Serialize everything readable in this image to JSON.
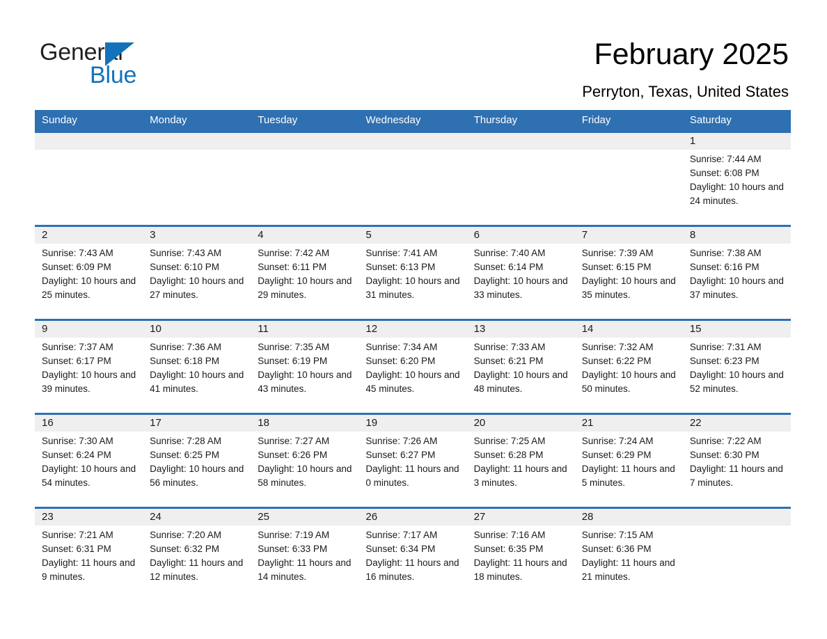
{
  "brand": {
    "name_part1": "General",
    "name_part2": "Blue",
    "triangle_color": "#1273ba",
    "text_color": "#231f20"
  },
  "header": {
    "title": "February 2025",
    "subtitle": "Perryton, Texas, United States"
  },
  "theme": {
    "header_bar_color": "#2E70B2",
    "day_band_color": "#efefef",
    "text_color": "#1a1a1a",
    "background": "#ffffff"
  },
  "weekdays": [
    "Sunday",
    "Monday",
    "Tuesday",
    "Wednesday",
    "Thursday",
    "Friday",
    "Saturday"
  ],
  "labels": {
    "sunrise_prefix": "Sunrise:",
    "sunset_prefix": "Sunset:",
    "daylight_prefix": "Daylight:"
  },
  "weeks": [
    [
      {
        "day": "",
        "empty": true
      },
      {
        "day": "",
        "empty": true
      },
      {
        "day": "",
        "empty": true
      },
      {
        "day": "",
        "empty": true
      },
      {
        "day": "",
        "empty": true
      },
      {
        "day": "",
        "empty": true
      },
      {
        "day": "1",
        "sunrise": "Sunrise: 7:44 AM",
        "sunset": "Sunset: 6:08 PM",
        "daylight": "Daylight: 10 hours and 24 minutes."
      }
    ],
    [
      {
        "day": "2",
        "sunrise": "Sunrise: 7:43 AM",
        "sunset": "Sunset: 6:09 PM",
        "daylight": "Daylight: 10 hours and 25 minutes."
      },
      {
        "day": "3",
        "sunrise": "Sunrise: 7:43 AM",
        "sunset": "Sunset: 6:10 PM",
        "daylight": "Daylight: 10 hours and 27 minutes."
      },
      {
        "day": "4",
        "sunrise": "Sunrise: 7:42 AM",
        "sunset": "Sunset: 6:11 PM",
        "daylight": "Daylight: 10 hours and 29 minutes."
      },
      {
        "day": "5",
        "sunrise": "Sunrise: 7:41 AM",
        "sunset": "Sunset: 6:13 PM",
        "daylight": "Daylight: 10 hours and 31 minutes."
      },
      {
        "day": "6",
        "sunrise": "Sunrise: 7:40 AM",
        "sunset": "Sunset: 6:14 PM",
        "daylight": "Daylight: 10 hours and 33 minutes."
      },
      {
        "day": "7",
        "sunrise": "Sunrise: 7:39 AM",
        "sunset": "Sunset: 6:15 PM",
        "daylight": "Daylight: 10 hours and 35 minutes."
      },
      {
        "day": "8",
        "sunrise": "Sunrise: 7:38 AM",
        "sunset": "Sunset: 6:16 PM",
        "daylight": "Daylight: 10 hours and 37 minutes."
      }
    ],
    [
      {
        "day": "9",
        "sunrise": "Sunrise: 7:37 AM",
        "sunset": "Sunset: 6:17 PM",
        "daylight": "Daylight: 10 hours and 39 minutes."
      },
      {
        "day": "10",
        "sunrise": "Sunrise: 7:36 AM",
        "sunset": "Sunset: 6:18 PM",
        "daylight": "Daylight: 10 hours and 41 minutes."
      },
      {
        "day": "11",
        "sunrise": "Sunrise: 7:35 AM",
        "sunset": "Sunset: 6:19 PM",
        "daylight": "Daylight: 10 hours and 43 minutes."
      },
      {
        "day": "12",
        "sunrise": "Sunrise: 7:34 AM",
        "sunset": "Sunset: 6:20 PM",
        "daylight": "Daylight: 10 hours and 45 minutes."
      },
      {
        "day": "13",
        "sunrise": "Sunrise: 7:33 AM",
        "sunset": "Sunset: 6:21 PM",
        "daylight": "Daylight: 10 hours and 48 minutes."
      },
      {
        "day": "14",
        "sunrise": "Sunrise: 7:32 AM",
        "sunset": "Sunset: 6:22 PM",
        "daylight": "Daylight: 10 hours and 50 minutes."
      },
      {
        "day": "15",
        "sunrise": "Sunrise: 7:31 AM",
        "sunset": "Sunset: 6:23 PM",
        "daylight": "Daylight: 10 hours and 52 minutes."
      }
    ],
    [
      {
        "day": "16",
        "sunrise": "Sunrise: 7:30 AM",
        "sunset": "Sunset: 6:24 PM",
        "daylight": "Daylight: 10 hours and 54 minutes."
      },
      {
        "day": "17",
        "sunrise": "Sunrise: 7:28 AM",
        "sunset": "Sunset: 6:25 PM",
        "daylight": "Daylight: 10 hours and 56 minutes."
      },
      {
        "day": "18",
        "sunrise": "Sunrise: 7:27 AM",
        "sunset": "Sunset: 6:26 PM",
        "daylight": "Daylight: 10 hours and 58 minutes."
      },
      {
        "day": "19",
        "sunrise": "Sunrise: 7:26 AM",
        "sunset": "Sunset: 6:27 PM",
        "daylight": "Daylight: 11 hours and 0 minutes."
      },
      {
        "day": "20",
        "sunrise": "Sunrise: 7:25 AM",
        "sunset": "Sunset: 6:28 PM",
        "daylight": "Daylight: 11 hours and 3 minutes."
      },
      {
        "day": "21",
        "sunrise": "Sunrise: 7:24 AM",
        "sunset": "Sunset: 6:29 PM",
        "daylight": "Daylight: 11 hours and 5 minutes."
      },
      {
        "day": "22",
        "sunrise": "Sunrise: 7:22 AM",
        "sunset": "Sunset: 6:30 PM",
        "daylight": "Daylight: 11 hours and 7 minutes."
      }
    ],
    [
      {
        "day": "23",
        "sunrise": "Sunrise: 7:21 AM",
        "sunset": "Sunset: 6:31 PM",
        "daylight": "Daylight: 11 hours and 9 minutes."
      },
      {
        "day": "24",
        "sunrise": "Sunrise: 7:20 AM",
        "sunset": "Sunset: 6:32 PM",
        "daylight": "Daylight: 11 hours and 12 minutes."
      },
      {
        "day": "25",
        "sunrise": "Sunrise: 7:19 AM",
        "sunset": "Sunset: 6:33 PM",
        "daylight": "Daylight: 11 hours and 14 minutes."
      },
      {
        "day": "26",
        "sunrise": "Sunrise: 7:17 AM",
        "sunset": "Sunset: 6:34 PM",
        "daylight": "Daylight: 11 hours and 16 minutes."
      },
      {
        "day": "27",
        "sunrise": "Sunrise: 7:16 AM",
        "sunset": "Sunset: 6:35 PM",
        "daylight": "Daylight: 11 hours and 18 minutes."
      },
      {
        "day": "28",
        "sunrise": "Sunrise: 7:15 AM",
        "sunset": "Sunset: 6:36 PM",
        "daylight": "Daylight: 11 hours and 21 minutes."
      },
      {
        "day": "",
        "empty": true
      }
    ]
  ]
}
